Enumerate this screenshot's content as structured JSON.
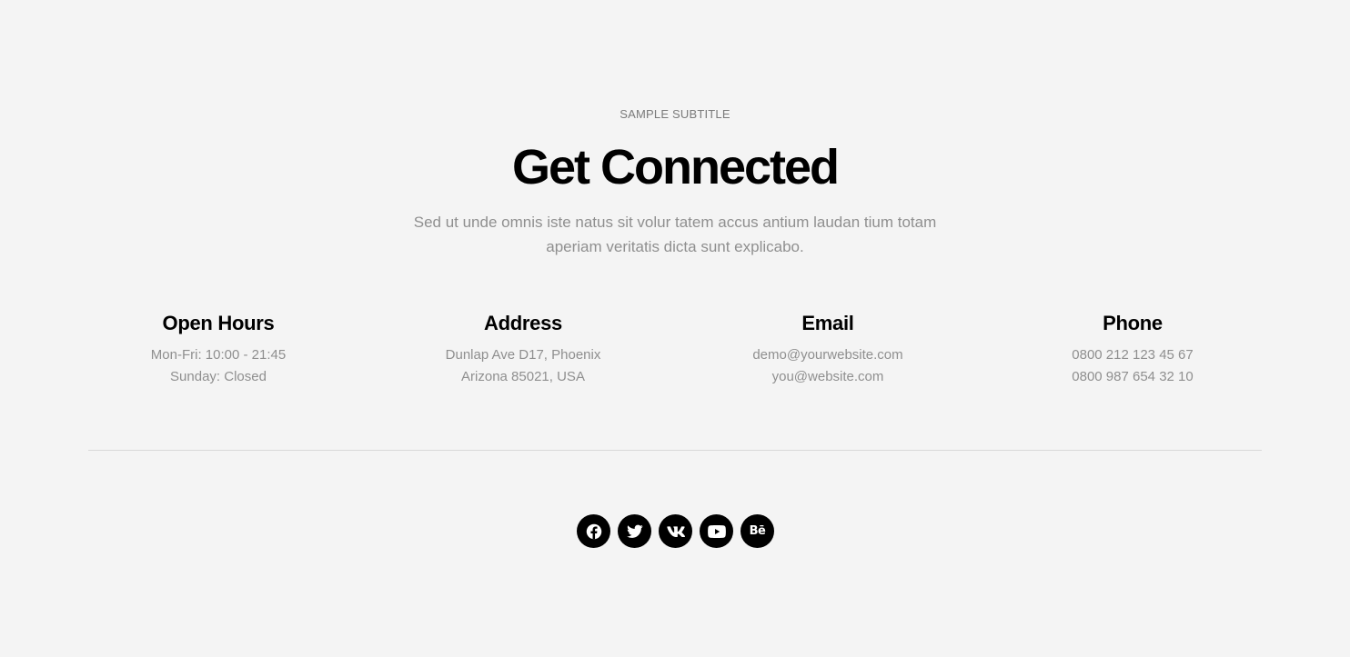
{
  "header": {
    "subtitle": "SAMPLE SUBTITLE",
    "title": "Get Connected",
    "description": "Sed ut unde omnis iste natus sit volur tatem accus antium laudan tium totam aperiam veritatis dicta sunt explicabo."
  },
  "info": {
    "hours": {
      "heading": "Open Hours",
      "line1": "Mon-Fri: 10:00 - 21:45",
      "line2": "Sunday: Closed"
    },
    "address": {
      "heading": "Address",
      "line1": "Dunlap Ave D17, Phoenix",
      "line2": "Arizona 85021, USA"
    },
    "email": {
      "heading": "Email",
      "line1": "demo@yourwebsite.com",
      "line2": "you@website.com"
    },
    "phone": {
      "heading": "Phone",
      "line1": "0800 212 123 45 67",
      "line2": "0800 987 654 32 10"
    }
  },
  "socials": {
    "behance_label": "Bē",
    "icons": [
      "facebook-icon",
      "twitter-icon",
      "vk-icon",
      "youtube-icon",
      "behance-icon"
    ]
  },
  "colors": {
    "background": "#f4f4f4",
    "heading": "#000000",
    "muted_text": "#8f8f8f",
    "divider": "#d8d8d8",
    "social_bg": "#000000",
    "social_icon": "#ffffff"
  }
}
